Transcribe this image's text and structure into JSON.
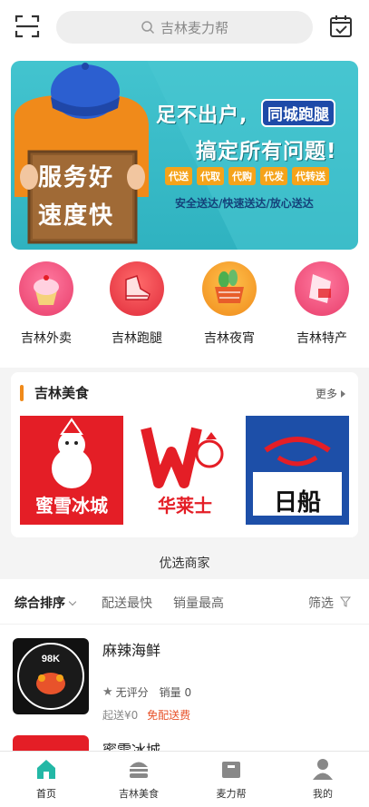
{
  "colors": {
    "accent": "#23b8a6",
    "banner": "#3bbdc9",
    "brand_red": "#e41e26",
    "free_delivery": "#e8532b",
    "section_bar": "#f08a1a"
  },
  "topbar": {
    "search_placeholder": "吉林麦力帮"
  },
  "banner": {
    "headline": "足不出户,",
    "tag": "同城跑腿",
    "subheadline": "搞定所有问题!",
    "chips": [
      "代送",
      "代取",
      "代购",
      "代发",
      "代转送"
    ],
    "slogan": "安全送达/快速送达/放心送达",
    "sign_line1": "服务好",
    "sign_line2": "速度快"
  },
  "categories": [
    {
      "label": "吉林外卖",
      "icon": "cupcake-icon"
    },
    {
      "label": "吉林跑腿",
      "icon": "running-shoe-icon"
    },
    {
      "label": "吉林夜宵",
      "icon": "vegetable-basket-icon"
    },
    {
      "label": "吉林特产",
      "icon": "specialty-gift-icon"
    }
  ],
  "food_section": {
    "title": "吉林美食",
    "more": "更多",
    "brands": [
      {
        "name": "蜜雪冰城"
      },
      {
        "name": "华莱士"
      },
      {
        "name": "日船"
      }
    ]
  },
  "featured_label": "优选商家",
  "sort": {
    "items": [
      "综合排序",
      "配送最快",
      "销量最高"
    ],
    "filter": "筛选"
  },
  "shops": [
    {
      "name": "麻辣海鲜",
      "rating": "无评分",
      "sales": "销量 0",
      "min_order": "起送¥0",
      "delivery": "免配送费",
      "logo_text": "98K"
    },
    {
      "name": "蜜雪冰城"
    }
  ],
  "tabs": [
    {
      "label": "首页",
      "icon": "home-icon"
    },
    {
      "label": "吉林美食",
      "icon": "burger-icon"
    },
    {
      "label": "麦力帮",
      "icon": "box-icon"
    },
    {
      "label": "我的",
      "icon": "user-icon"
    }
  ]
}
